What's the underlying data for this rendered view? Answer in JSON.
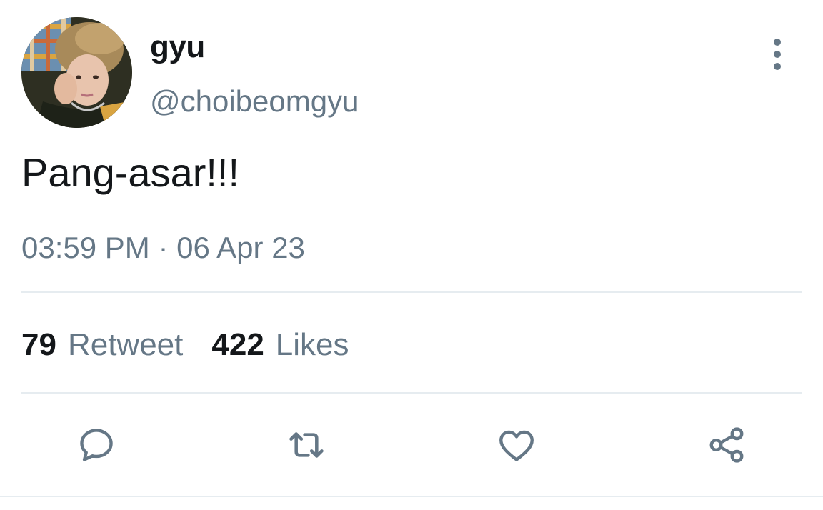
{
  "tweet": {
    "display_name": "gyu",
    "handle": "@choibeomgyu",
    "text": "Pang-asar!!!",
    "timestamp": "03:59 PM · 06 Apr 23"
  },
  "stats": {
    "retweets_count": "79",
    "retweets_label": "Retweet",
    "likes_count": "422",
    "likes_label": "Likes"
  },
  "actions": {
    "icons": [
      "reply-icon",
      "retweet-icon",
      "like-icon",
      "share-icon"
    ]
  },
  "colors": {
    "primary_text": "#14171a",
    "secondary_text": "#657786",
    "divider": "#e6ecf0",
    "background": "#ffffff"
  }
}
